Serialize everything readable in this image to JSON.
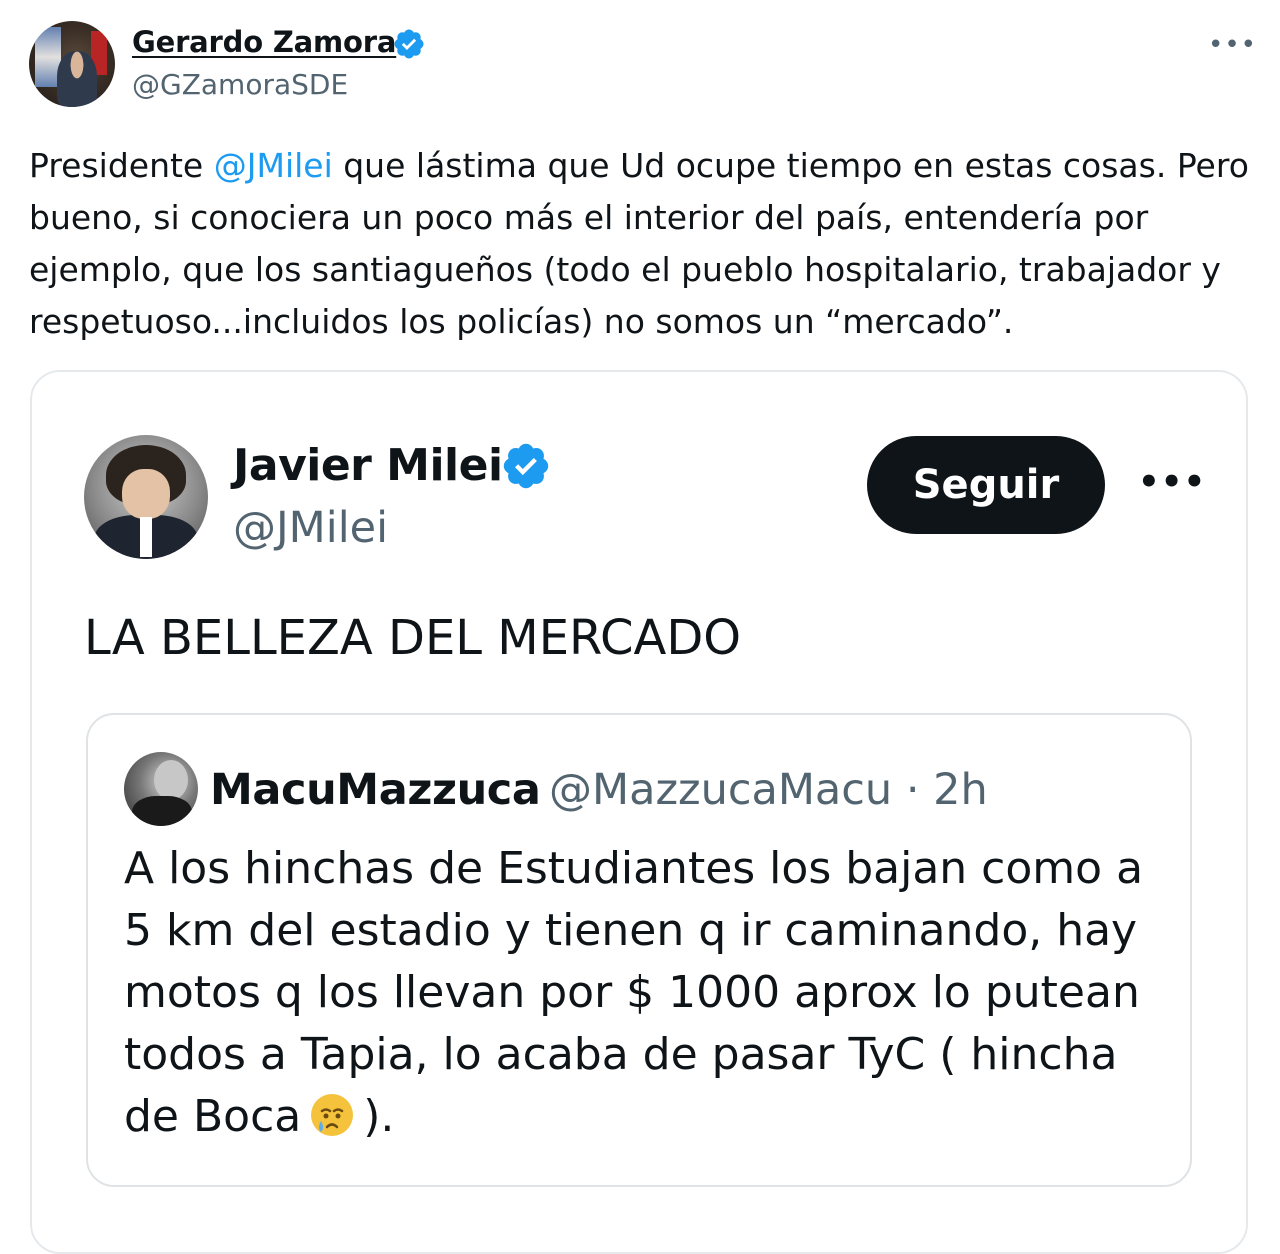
{
  "author": {
    "name": "Gerardo Zamora",
    "handle": "@GZamoraSDE",
    "more_icon": "more-horizontal-icon"
  },
  "tweet": {
    "prefix": "Presidente ",
    "mention": "@JMilei",
    "body": " que lástima  que Ud ocupe tiempo en estas cosas. Pero bueno, si conociera  un poco más el interior del país, entendería por ejemplo,  que los santiagueños (todo el pueblo hospitalario, trabajador y respetuoso...incluidos los policías) no somos un “mercado”."
  },
  "embedded": {
    "name": "Javier Milei",
    "handle": "@JMilei",
    "follow_label": "Seguir",
    "text": "LA BELLEZA DEL MERCADO",
    "quote": {
      "name": "MacuMazzuca",
      "handle_time": "@MazzucaMacu · 2h",
      "text": "A los hinchas de Estudiantes los bajan como a 5 km del estadio y tienen q ir caminando, hay motos q los llevan por $ 1000 aprox lo putean todos a Tapia, lo acaba de pasar TyC ( hincha de Boca",
      "text_end": ")."
    }
  },
  "colors": {
    "accent": "#1d9bf0",
    "text": "#0f1419",
    "secondary": "#536471",
    "button": "#0f1419"
  }
}
